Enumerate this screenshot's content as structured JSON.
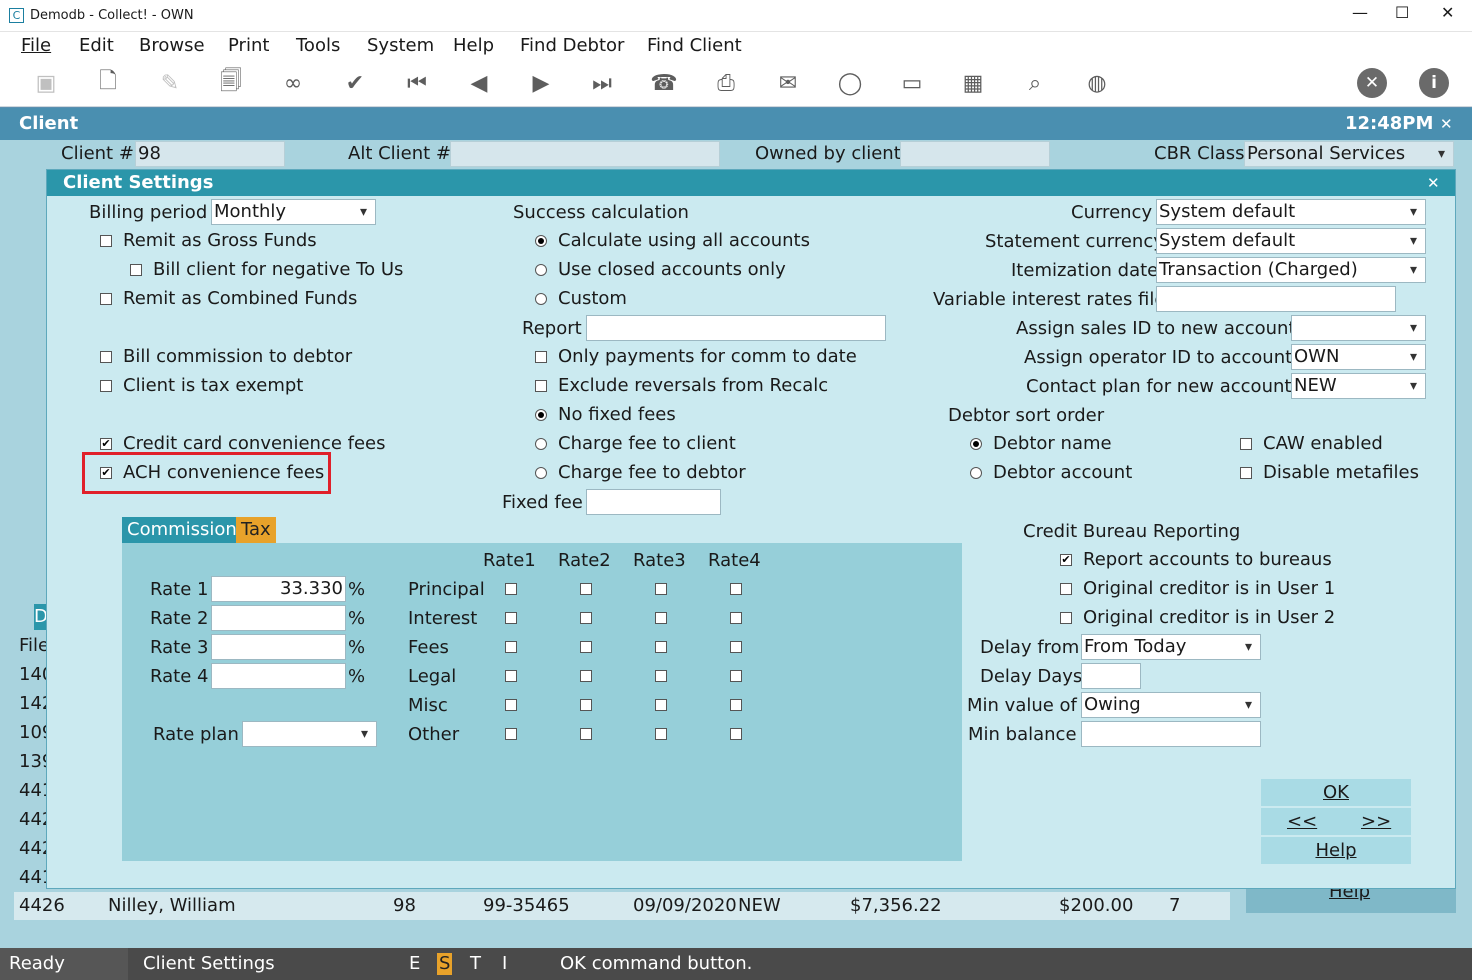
{
  "window": {
    "title": "Demodb - Collect! - OWN",
    "app_icon": "C"
  },
  "menu": [
    "File",
    "Edit",
    "Browse",
    "Print",
    "Tools",
    "System",
    "Help",
    "Find Debtor",
    "Find Client"
  ],
  "toolbar_icons": [
    "save-icon",
    "new-doc-icon",
    "edit-doc-icon",
    "search-doc-icon",
    "binoculars-icon",
    "check-icon",
    "first-icon",
    "prev-icon",
    "next-icon",
    "last-icon",
    "phone-icon",
    "print-icon",
    "mail-icon",
    "chat-icon",
    "card-payment-icon",
    "calendar-add-icon",
    "search-icon",
    "globe-icon",
    "delete-icon",
    "info-icon"
  ],
  "client_bar": {
    "title": "Client",
    "time": "12:48PM",
    "close": "✕"
  },
  "client_header": {
    "client_no_label": "Client #",
    "client_no": "98",
    "alt_client_label": "Alt Client #",
    "alt_client": "",
    "owned_label": "Owned by client",
    "owned": "",
    "cbr_label": "CBR Class",
    "cbr": "Personal Services"
  },
  "back_list": {
    "tab_label": "D",
    "header": "File",
    "file_numbers": [
      "140",
      "142",
      "109",
      "139",
      "441",
      "442",
      "442",
      "441"
    ],
    "last_row": {
      "file": "4426",
      "name": "Nilley, William",
      "client": "98",
      "account": "99-35465",
      "date": "09/09/2020",
      "status": "NEW",
      "owing": "$7,356.22",
      "amount": "$200.00",
      "count": "7"
    },
    "help_label": "Help"
  },
  "dialog": {
    "title": "Client Settings",
    "close": "✕",
    "billing_period_label": "Billing period",
    "billing_period": "Monthly",
    "left_checks": {
      "remit_gross": "Remit as Gross Funds",
      "bill_negative": "Bill client for negative To Us",
      "remit_combined": "Remit as Combined Funds",
      "bill_commission": "Bill commission to debtor",
      "tax_exempt": "Client is tax exempt",
      "cc_fees": "Credit card convenience fees",
      "ach_fees": "ACH convenience fees"
    },
    "success_label": "Success calculation",
    "success_options": [
      "Calculate using all accounts",
      "Use closed accounts only",
      "Custom"
    ],
    "report_label": "Report",
    "report": "",
    "mid_checks": {
      "only_payments": "Only payments for comm to date",
      "exclude_reversals": "Exclude reversals from Recalc"
    },
    "fee_options": [
      "No fixed fees",
      "Charge fee to client",
      "Charge fee to debtor"
    ],
    "fixed_fee_label": "Fixed fee",
    "fixed_fee": "",
    "right": {
      "currency_label": "Currency",
      "currency": "System default",
      "stmt_currency_label": "Statement currency",
      "stmt_currency": "System default",
      "itemization_label": "Itemization date",
      "itemization": "Transaction (Charged)",
      "var_interest_label": "Variable interest rates file",
      "var_interest": "",
      "sales_id_label": "Assign sales ID to new accounts",
      "sales_id": "",
      "operator_id_label": "Assign operator ID to accounts",
      "operator_id": "OWN",
      "contact_plan_label": "Contact plan for new accounts",
      "contact_plan": "NEW",
      "sort_label": "Debtor sort order",
      "sort_options": [
        "Debtor name",
        "Debtor account"
      ],
      "caw_label": "CAW enabled",
      "metafiles_label": "Disable metafiles"
    },
    "tabs": {
      "commission": "Commission",
      "tax": "Tax"
    },
    "rate_headers": [
      "Rate1",
      "Rate2",
      "Rate3",
      "Rate4"
    ],
    "rates": [
      {
        "label": "Rate 1",
        "value": "33.330",
        "unit": "%"
      },
      {
        "label": "Rate 2",
        "value": "",
        "unit": "%"
      },
      {
        "label": "Rate 3",
        "value": "",
        "unit": "%"
      },
      {
        "label": "Rate 4",
        "value": "",
        "unit": "%"
      }
    ],
    "categories": [
      "Principal",
      "Interest",
      "Fees",
      "Legal",
      "Misc",
      "Other"
    ],
    "rate_plan_label": "Rate plan",
    "rate_plan": "",
    "cbr": {
      "title": "Credit Bureau Reporting",
      "report_label": "Report accounts to bureaus",
      "user1_label": "Original creditor is in User 1",
      "user2_label": "Original creditor is in User 2",
      "delay_from_label": "Delay from",
      "delay_from": "From Today",
      "delay_days_label": "Delay Days",
      "delay_days": "",
      "min_value_label": "Min value of",
      "min_value": "Owing",
      "min_balance_label": "Min balance",
      "min_balance": ""
    },
    "buttons": {
      "ok": "OK",
      "prev": "<<",
      "next": ">>",
      "help": "Help"
    }
  },
  "status": {
    "ready": "Ready",
    "context": "Client Settings",
    "flags": [
      "E",
      "S",
      "T",
      "I"
    ],
    "message": "OK command button."
  }
}
